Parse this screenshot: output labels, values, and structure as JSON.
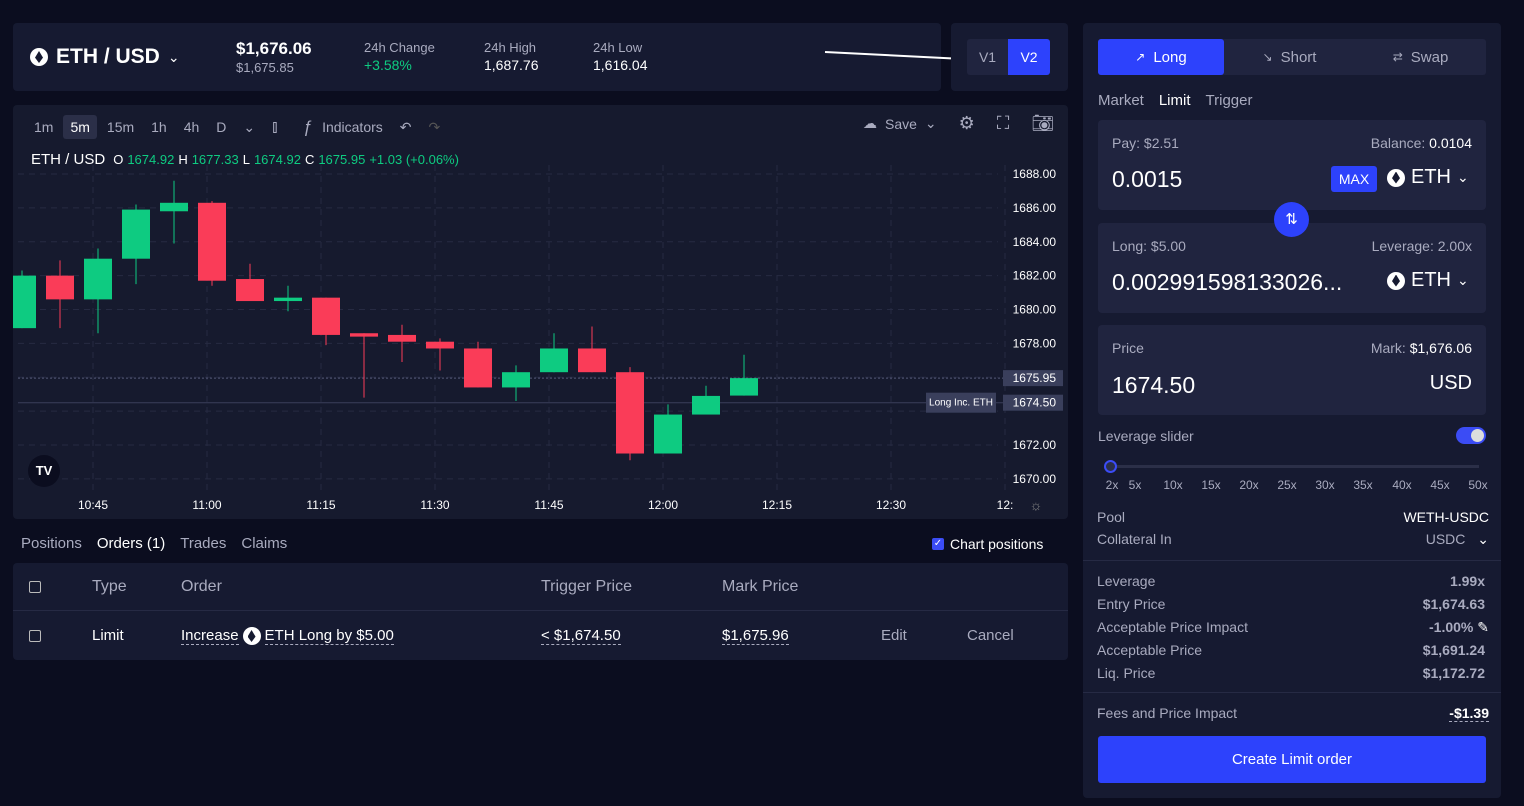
{
  "header": {
    "pair": "ETH / USD",
    "price": "$1,676.06",
    "index_price": "$1,675.85",
    "change_label": "24h Change",
    "change_value": "+3.58%",
    "high_label": "24h High",
    "high_value": "1,687.76",
    "low_label": "24h Low",
    "low_value": "1,616.04"
  },
  "version": {
    "v1": "V1",
    "v2": "V2"
  },
  "toolbar": {
    "intervals": [
      "1m",
      "5m",
      "15m",
      "1h",
      "4h",
      "D"
    ],
    "active_interval": "5m",
    "indicators": "Indicators",
    "save": "Save"
  },
  "legend": {
    "pair": "ETH / USD",
    "o_label": "O",
    "o": "1674.92",
    "h_label": "H",
    "h": "1677.33",
    "l_label": "L",
    "l": "1674.92",
    "c_label": "C",
    "c": "1675.95",
    "change": "+1.03 (+0.06%)"
  },
  "chart_data": {
    "type": "candlestick",
    "x_ticks": [
      "10:45",
      "11:00",
      "11:15",
      "11:30",
      "11:45",
      "12:00",
      "12:15",
      "12:30",
      "12:"
    ],
    "y_ticks": [
      "1688.00",
      "1686.00",
      "1684.00",
      "1682.00",
      "1680.00",
      "1678.00",
      "1672.00",
      "1670.00"
    ],
    "ylim": [
      1669.5,
      1688.7
    ],
    "grid": true,
    "price_labels": [
      {
        "value": "1675.95"
      },
      {
        "value": "1674.50",
        "tag": "Long Inc. ETH"
      }
    ],
    "candles": [
      {
        "t": "10:35",
        "o": 1678.9,
        "h": 1682.3,
        "l": 1678.9,
        "c": 1682.0
      },
      {
        "t": "10:40",
        "o": 1682.0,
        "h": 1682.9,
        "l": 1678.9,
        "c": 1680.6
      },
      {
        "t": "10:45",
        "o": 1680.6,
        "h": 1683.6,
        "l": 1678.6,
        "c": 1683.0
      },
      {
        "t": "10:50",
        "o": 1683.0,
        "h": 1686.2,
        "l": 1681.5,
        "c": 1685.9
      },
      {
        "t": "10:55",
        "o": 1685.8,
        "h": 1687.6,
        "l": 1683.9,
        "c": 1686.3
      },
      {
        "t": "11:00",
        "o": 1686.3,
        "h": 1686.4,
        "l": 1681.4,
        "c": 1681.7
      },
      {
        "t": "11:05",
        "o": 1681.8,
        "h": 1682.7,
        "l": 1680.5,
        "c": 1680.5
      },
      {
        "t": "11:10",
        "o": 1680.5,
        "h": 1681.4,
        "l": 1679.9,
        "c": 1680.7
      },
      {
        "t": "11:15",
        "o": 1680.7,
        "h": 1680.7,
        "l": 1677.9,
        "c": 1678.5
      },
      {
        "t": "11:20",
        "o": 1678.6,
        "h": 1678.6,
        "l": 1674.8,
        "c": 1678.4
      },
      {
        "t": "11:25",
        "o": 1678.5,
        "h": 1679.1,
        "l": 1676.9,
        "c": 1678.1
      },
      {
        "t": "11:30",
        "o": 1678.1,
        "h": 1678.3,
        "l": 1676.4,
        "c": 1677.7
      },
      {
        "t": "11:35",
        "o": 1677.7,
        "h": 1678.1,
        "l": 1675.4,
        "c": 1675.4
      },
      {
        "t": "11:40",
        "o": 1675.4,
        "h": 1676.7,
        "l": 1674.6,
        "c": 1676.3
      },
      {
        "t": "11:45",
        "o": 1676.3,
        "h": 1678.6,
        "l": 1676.3,
        "c": 1677.7
      },
      {
        "t": "11:50",
        "o": 1677.7,
        "h": 1679.0,
        "l": 1676.3,
        "c": 1676.3
      },
      {
        "t": "11:55",
        "o": 1676.3,
        "h": 1676.6,
        "l": 1671.1,
        "c": 1671.5
      },
      {
        "t": "12:00",
        "o": 1671.5,
        "h": 1674.4,
        "l": 1671.5,
        "c": 1673.8
      },
      {
        "t": "12:05",
        "o": 1673.8,
        "h": 1675.5,
        "l": 1673.8,
        "c": 1674.9
      },
      {
        "t": "12:10",
        "o": 1674.92,
        "h": 1677.33,
        "l": 1674.92,
        "c": 1675.95
      }
    ],
    "colors": {
      "up": "#0ecb81",
      "down": "#fa3c58"
    }
  },
  "bottom": {
    "tabs": [
      "Positions",
      "Orders (1)",
      "Trades",
      "Claims"
    ],
    "active_tab": "Orders (1)",
    "chart_positions": "Chart positions",
    "columns": [
      "Type",
      "Order",
      "Trigger Price",
      "Mark Price"
    ],
    "rows": [
      {
        "type": "Limit",
        "order_action": "Increase",
        "order_desc": "ETH Long by $5.00",
        "trigger": "< $1,674.50",
        "mark": "$1,675.96",
        "edit": "Edit",
        "cancel": "Cancel"
      }
    ]
  },
  "trade": {
    "tabs": [
      "Long",
      "Short",
      "Swap"
    ],
    "active_tab": "Long",
    "order_types": [
      "Market",
      "Limit",
      "Trigger"
    ],
    "active_order_type": "Limit",
    "pay_label": "Pay: $2.51",
    "balance_label": "Balance: ",
    "balance": "0.0104",
    "pay_amount": "0.0015",
    "max": "MAX",
    "pay_token": "ETH",
    "long_label": "Long: $5.00",
    "leverage_label": "Leverage: 2.00x",
    "long_amount": "0.002991598133026...",
    "long_token": "ETH",
    "price_label": "Price",
    "mark_label": "Mark: ",
    "mark": "$1,676.06",
    "price_value": "1674.50",
    "price_unit": "USD",
    "slider_label": "Leverage slider",
    "slider_enabled": true,
    "slider_marks": [
      "2x",
      "5x",
      "10x",
      "15x",
      "20x",
      "25x",
      "30x",
      "35x",
      "40x",
      "45x",
      "50x"
    ],
    "slider_value": "2x",
    "pool_label": "Pool",
    "pool": "WETH-USDC",
    "collateral_label": "Collateral In",
    "collateral": "USDC",
    "details": [
      {
        "label": "Leverage",
        "value": "1.99x"
      },
      {
        "label": "Entry Price",
        "value": "$1,674.63"
      },
      {
        "label": "Acceptable Price Impact",
        "value": "-1.00%"
      },
      {
        "label": "Acceptable Price",
        "value": "$1,691.24"
      },
      {
        "label": "Liq. Price",
        "value": "$1,172.72"
      }
    ],
    "fees_label": "Fees and Price Impact",
    "fees": "-$1.39",
    "submit": "Create Limit order"
  },
  "colors": {
    "accent": "#2d42fc",
    "up": "#0ecb81",
    "down": "#fa3c58",
    "bg": "#0b0d1f",
    "panel": "#161a31"
  }
}
